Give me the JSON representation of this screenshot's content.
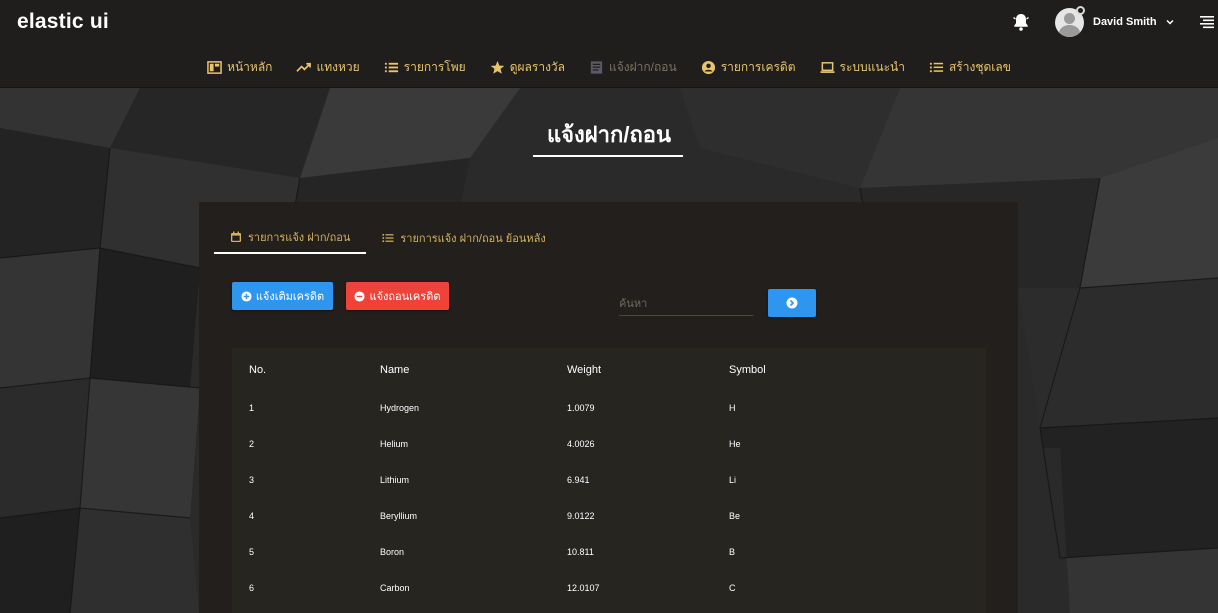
{
  "brand": "elastic ui",
  "user": {
    "name": "David Smith"
  },
  "nav": [
    {
      "label": "หน้าหลัก",
      "icon": "dashboard-icon"
    },
    {
      "label": "แทงหวย",
      "icon": "trending-up-icon"
    },
    {
      "label": "รายการโพย",
      "icon": "list-icon"
    },
    {
      "label": "ดูผลรางวัล",
      "icon": "star-icon"
    },
    {
      "label": "แจ้งฝาก/ถอน",
      "icon": "receipt-icon"
    },
    {
      "label": "รายการเครดิต",
      "icon": "account-circle-icon"
    },
    {
      "label": "ระบบแนะนำ",
      "icon": "laptop-icon"
    },
    {
      "label": "สร้างชุดเลข",
      "icon": "list-numbered-icon"
    }
  ],
  "active_nav": "แจ้งฝาก/ถอน",
  "page_title": "แจ้งฝาก/ถอน",
  "tabs": [
    {
      "label": "รายการแจ้ง ฝาก/ถอน",
      "icon": "calendar-icon",
      "active": true
    },
    {
      "label": "รายการแจ้ง ฝาก/ถอน ย้อนหลัง",
      "icon": "list-icon",
      "active": false
    }
  ],
  "actions": {
    "deposit_label": "แจ้งเติมเครดิต",
    "withdraw_label": "แจ้งถอนเครดิต"
  },
  "search": {
    "placeholder": "ค้นหา",
    "value": ""
  },
  "table": {
    "headers": [
      "No.",
      "Name",
      "Weight",
      "Symbol"
    ],
    "rows": [
      [
        "1",
        "Hydrogen",
        "1.0079",
        "H"
      ],
      [
        "2",
        "Helium",
        "4.0026",
        "He"
      ],
      [
        "3",
        "Lithium",
        "6.941",
        "Li"
      ],
      [
        "4",
        "Beryllium",
        "9.0122",
        "Be"
      ],
      [
        "5",
        "Boron",
        "10.811",
        "B"
      ],
      [
        "6",
        "Carbon",
        "12.0107",
        "C"
      ]
    ]
  },
  "colors": {
    "topbar": "#1f1e1c",
    "nav_text": "#e9c46a",
    "nav_active": "#7a7263",
    "tab_text": "#d4b360",
    "card": "#221f1c",
    "table": "#272520",
    "primary": "#2f96f0",
    "danger": "#ef433a"
  }
}
